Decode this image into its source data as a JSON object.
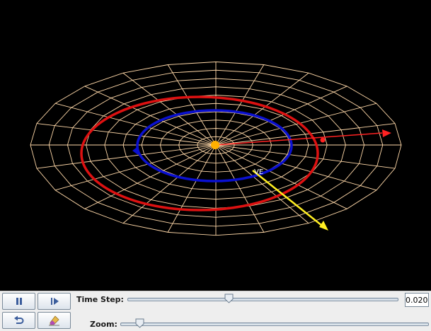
{
  "simulation": {
    "vector_label": "VE",
    "colors": {
      "background": "#000000",
      "grid": "#ffd8a8",
      "outer_orbit": "#dd1111",
      "inner_orbit": "#0a10d0",
      "sun": "#ffb000",
      "radial_vector": "#ff2222",
      "velocity_vector": "#ffee22"
    }
  },
  "controls": {
    "buttons": [
      {
        "name": "pause-button",
        "icon": "pause-icon"
      },
      {
        "name": "step-forward-button",
        "icon": "step-forward-icon"
      },
      {
        "name": "reset-button",
        "icon": "undo-icon"
      },
      {
        "name": "clear-trails-button",
        "icon": "eraser-icon"
      }
    ],
    "time_step": {
      "label": "Time Step:",
      "value": "0.020",
      "slider_fraction": 0.37
    },
    "zoom": {
      "label": "Zoom:",
      "slider_fraction": 0.05
    }
  }
}
